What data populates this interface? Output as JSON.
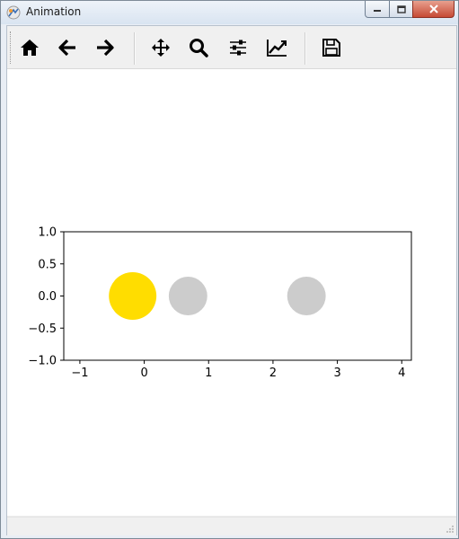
{
  "window": {
    "title": "Animation",
    "app_icon": "matplotlib-tool-icon",
    "controls": [
      "minimize-icon",
      "maximize-icon",
      "close-icon"
    ]
  },
  "toolbar": {
    "buttons": [
      {
        "name": "home",
        "icon": "home-icon"
      },
      {
        "name": "back",
        "icon": "arrow-left-icon"
      },
      {
        "name": "forward",
        "icon": "arrow-right-icon"
      },
      {
        "name": "pan",
        "icon": "move-icon"
      },
      {
        "name": "zoom",
        "icon": "magnifier-icon"
      },
      {
        "name": "subplots",
        "icon": "sliders-icon"
      },
      {
        "name": "edit-axes",
        "icon": "line-chart-icon"
      },
      {
        "name": "save",
        "icon": "floppy-disk-icon"
      }
    ]
  },
  "chart_data": {
    "type": "scatter",
    "title": "",
    "xlabel": "",
    "ylabel": "",
    "xlim": [
      -1.25,
      4.15
    ],
    "ylim": [
      -1.0,
      1.0
    ],
    "xticks": [
      -1,
      0,
      1,
      2,
      3,
      4
    ],
    "xtick_labels": [
      "−1",
      "0",
      "1",
      "2",
      "3",
      "4"
    ],
    "yticks": [
      1.0,
      0.5,
      0.0,
      -0.5,
      -1.0
    ],
    "ytick_labels": [
      "1.0",
      "0.5",
      "0.0",
      "−0.5",
      "−1.0"
    ],
    "grid": false,
    "points": [
      {
        "x": -0.18,
        "y": 0.0,
        "radius": 0.37,
        "color": "#ffdd00"
      },
      {
        "x": 0.68,
        "y": 0.0,
        "radius": 0.3,
        "color": "#cccccc"
      },
      {
        "x": 2.52,
        "y": 0.0,
        "radius": 0.3,
        "color": "#cccccc"
      }
    ]
  }
}
